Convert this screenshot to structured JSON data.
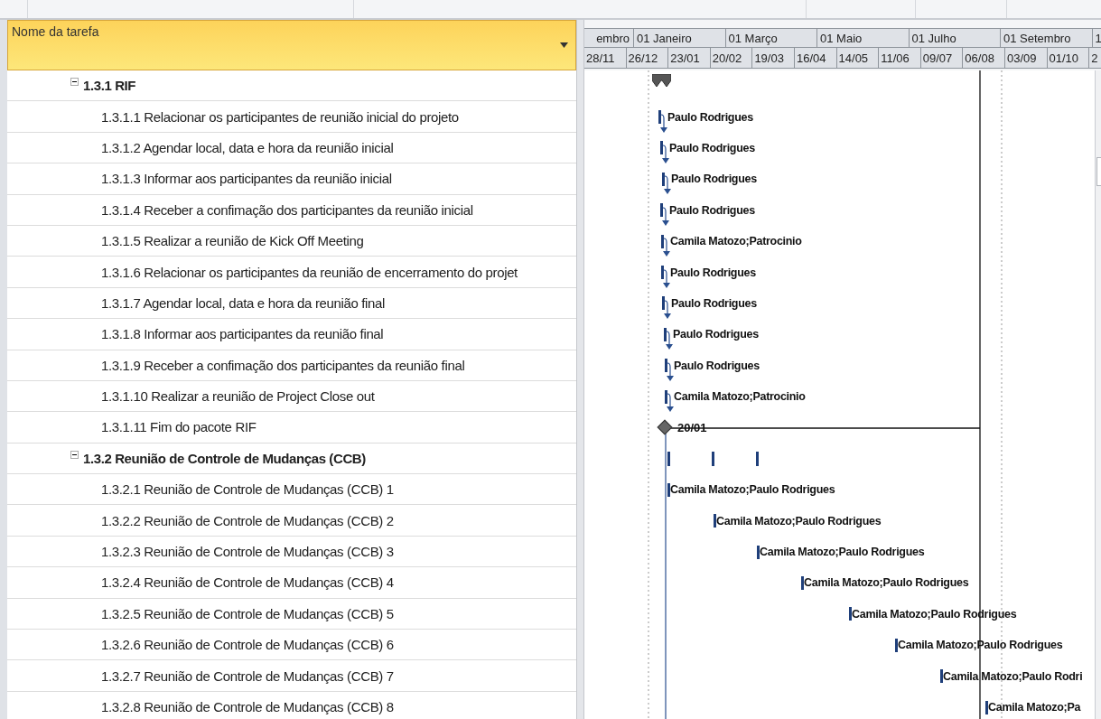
{
  "task_table": {
    "column": "Nome da tarefa",
    "rows": [
      {
        "name": "1.3.1 RIF",
        "expanded": true,
        "children": [
          {
            "name": "1.3.1.1 Relacionar os participantes de reunião inicial do projeto"
          },
          {
            "name": "1.3.1.2 Agendar local, data e hora da reunião inicial"
          },
          {
            "name": "1.3.1.3 Informar aos participantes da reunião inicial"
          },
          {
            "name": "1.3.1.4 Receber a confimação dos participantes da reunião inicial"
          },
          {
            "name": "1.3.1.5 Realizar a reunião de Kick Off Meeting"
          },
          {
            "name": "1.3.1.6 Relacionar os participantes da reunião de encerramento do projet"
          },
          {
            "name": "1.3.1.7 Agendar local, data e hora da reunião final"
          },
          {
            "name": "1.3.1.8 Informar aos participantes da reunião final"
          },
          {
            "name": "1.3.1.9 Receber a confimação dos participantes da reunião final"
          },
          {
            "name": "1.3.1.10 Realizar a reunião de Project Close out"
          },
          {
            "name": "1.3.1.11 Fim do pacote RIF"
          }
        ]
      },
      {
        "name": "1.3.2 Reunião de Controle de Mudanças (CCB)",
        "expanded": true,
        "children": [
          {
            "name": "1.3.2.1 Reunião de Controle de Mudanças (CCB) 1"
          },
          {
            "name": "1.3.2.2 Reunião de Controle de Mudanças (CCB) 2"
          },
          {
            "name": "1.3.2.3 Reunião de Controle de Mudanças (CCB) 3"
          },
          {
            "name": "1.3.2.4 Reunião de Controle de Mudanças (CCB) 4"
          },
          {
            "name": "1.3.2.5 Reunião de Controle de Mudanças (CCB) 5"
          },
          {
            "name": "1.3.2.6 Reunião de Controle de Mudanças (CCB) 6"
          },
          {
            "name": "1.3.2.7 Reunião de Controle de Mudanças (CCB) 7"
          },
          {
            "name": "1.3.2.8 Reunião de Controle de Mudanças (CCB) 8"
          }
        ]
      }
    ]
  },
  "timescale": {
    "major": [
      "embro",
      "01 Janeiro",
      "01 Março",
      "01 Maio",
      "01 Julho",
      "01 Setembro",
      "1"
    ],
    "minor": [
      "28/11",
      "26/12",
      "23/01",
      "20/02",
      "19/03",
      "16/04",
      "14/05",
      "11/06",
      "09/07",
      "06/08",
      "03/09",
      "01/10",
      "2"
    ]
  },
  "gantt_rows": [
    {
      "kind": "summary"
    },
    {
      "kind": "task",
      "resource": "Paulo Rodrigues"
    },
    {
      "kind": "task",
      "resource": "Paulo Rodrigues"
    },
    {
      "kind": "task",
      "resource": "Paulo Rodrigues"
    },
    {
      "kind": "task",
      "resource": "Paulo Rodrigues"
    },
    {
      "kind": "task",
      "resource": "Camila Matozo;Patrocinio"
    },
    {
      "kind": "task",
      "resource": "Paulo Rodrigues"
    },
    {
      "kind": "task",
      "resource": "Paulo Rodrigues"
    },
    {
      "kind": "task",
      "resource": "Paulo Rodrigues"
    },
    {
      "kind": "task",
      "resource": "Paulo Rodrigues"
    },
    {
      "kind": "task",
      "resource": "Camila Matozo;Patrocinio"
    },
    {
      "kind": "milestone",
      "label": "20/01"
    },
    {
      "kind": "recurring"
    },
    {
      "kind": "occurrence",
      "resource": "Camila Matozo;Paulo Rodrigues"
    },
    {
      "kind": "occurrence",
      "resource": "Camila Matozo;Paulo Rodrigues"
    },
    {
      "kind": "occurrence",
      "resource": "Camila Matozo;Paulo Rodrigues"
    },
    {
      "kind": "occurrence",
      "resource": "Camila Matozo;Paulo Rodrigues"
    },
    {
      "kind": "occurrence",
      "resource": "Camila Matozo;Paulo Rodrigues"
    },
    {
      "kind": "occurrence",
      "resource": "Camila Matozo;Paulo Rodrigues"
    },
    {
      "kind": "occurrence",
      "resource": "Camila Matozo;Paulo Rodri"
    },
    {
      "kind": "occurrence",
      "resource": "Camila Matozo;Pa"
    }
  ]
}
